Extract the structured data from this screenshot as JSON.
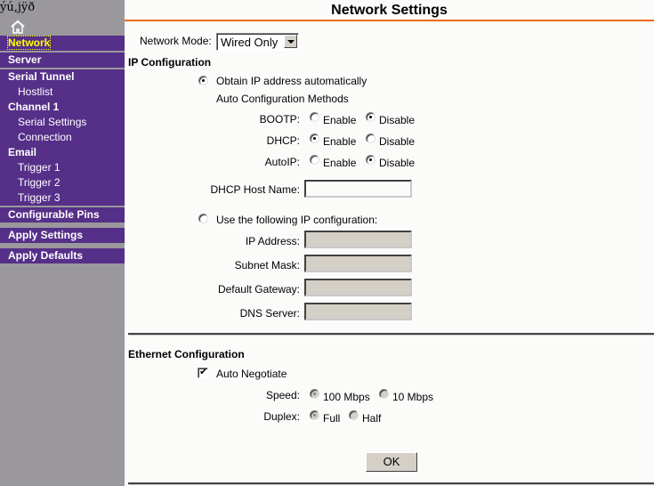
{
  "sidebar": {
    "garbled_header": "ýú,j\u0004ÿð",
    "home_icon": "home-icon",
    "items": [
      {
        "label": "Network",
        "active": true
      },
      {
        "label": "Server"
      },
      {
        "label": "Serial Tunnel"
      },
      {
        "label": "Hostlist",
        "sub": true
      },
      {
        "label": "Channel 1"
      },
      {
        "label": "Serial Settings",
        "sub": true
      },
      {
        "label": "Connection",
        "sub": true
      },
      {
        "label": "Email"
      },
      {
        "label": "Trigger 1",
        "sub": true
      },
      {
        "label": "Trigger 2",
        "sub": true
      },
      {
        "label": "Trigger 3",
        "sub": true
      },
      {
        "label": "Configurable Pins"
      },
      {
        "label": "Apply Settings"
      },
      {
        "label": "Apply Defaults"
      }
    ]
  },
  "page": {
    "title": "Network Settings",
    "accent_color": "#ee6a1e",
    "network_mode": {
      "label": "Network Mode:",
      "value": "Wired Only"
    },
    "ip_config": {
      "heading": "IP Configuration",
      "auto_option": "Obtain IP address automatically",
      "auto_methods_label": "Auto Configuration Methods",
      "methods": [
        {
          "label": "BOOTP:",
          "enable": "Enable",
          "disable": "Disable",
          "selected": "Disable"
        },
        {
          "label": "DHCP:",
          "enable": "Enable",
          "disable": "Disable",
          "selected": "Enable"
        },
        {
          "label": "AutoIP:",
          "enable": "Enable",
          "disable": "Disable",
          "selected": "Disable"
        }
      ],
      "dhcp_host_name": {
        "label": "DHCP Host Name:",
        "value": ""
      },
      "manual_option": "Use the following IP configuration:",
      "fields": [
        {
          "label": "IP Address:",
          "value": ""
        },
        {
          "label": "Subnet Mask:",
          "value": ""
        },
        {
          "label": "Default Gateway:",
          "value": ""
        },
        {
          "label": "DNS Server:",
          "value": ""
        }
      ]
    },
    "ethernet": {
      "heading": "Ethernet Configuration",
      "auto_negotiate": {
        "label": "Auto Negotiate",
        "checked": true
      },
      "speed": {
        "label": "Speed:",
        "options": [
          "100 Mbps",
          "10 Mbps"
        ],
        "selected": "100 Mbps"
      },
      "duplex": {
        "label": "Duplex:",
        "options": [
          "Full",
          "Half"
        ],
        "selected": "Full"
      }
    },
    "ok_label": "OK"
  }
}
